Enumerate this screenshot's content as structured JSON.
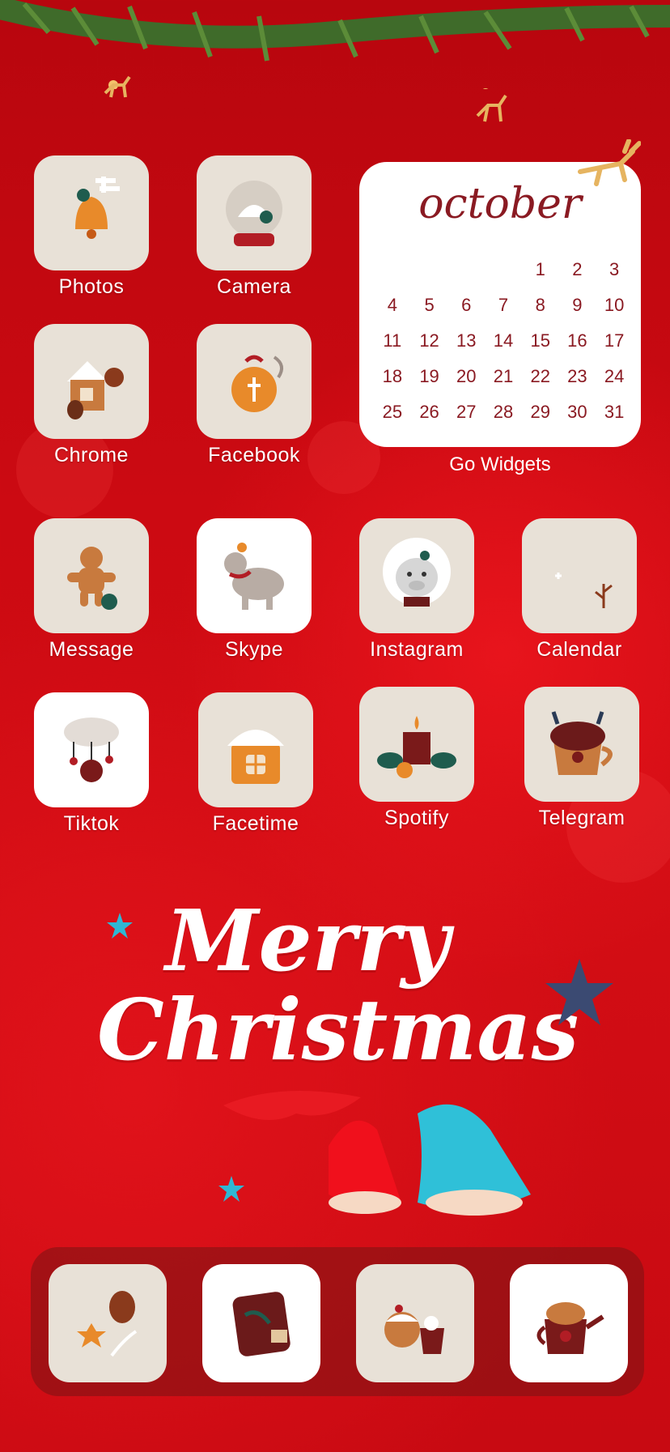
{
  "apps_top": [
    {
      "label": "Photos",
      "icon": "bell-snowflake-icon"
    },
    {
      "label": "Camera",
      "icon": "snow-globe-icon"
    },
    {
      "label": "Chrome",
      "icon": "gingerbread-house-icon"
    },
    {
      "label": "Facebook",
      "icon": "ornament-icon"
    }
  ],
  "widget": {
    "month": "october",
    "days": [
      "",
      "",
      "",
      "",
      "1",
      "2",
      "3",
      "4",
      "5",
      "6",
      "7",
      "8",
      "9",
      "10",
      "11",
      "12",
      "13",
      "14",
      "15",
      "16",
      "17",
      "18",
      "19",
      "20",
      "21",
      "22",
      "23",
      "24",
      "25",
      "26",
      "27",
      "28",
      "29",
      "30",
      "31"
    ],
    "label": "Go Widgets"
  },
  "apps_row3": [
    {
      "label": "Message",
      "icon": "gingerbread-man-icon"
    },
    {
      "label": "Skype",
      "icon": "reindeer-icon"
    },
    {
      "label": "Instagram",
      "icon": "cow-icon"
    },
    {
      "label": "Calendar",
      "icon": "crescent-moon-icon"
    }
  ],
  "apps_row4": [
    {
      "label": "Tiktok",
      "icon": "cloud-ornaments-icon"
    },
    {
      "label": "Facetime",
      "icon": "snowy-house-icon"
    },
    {
      "label": "Spotify",
      "icon": "candle-wreath-icon"
    },
    {
      "label": "Telegram",
      "icon": "reindeer-cup-icon"
    }
  ],
  "banner": {
    "line1": "Merry",
    "line2": "Christmas"
  },
  "dock": [
    {
      "icon": "pinecone-cookie-icon"
    },
    {
      "icon": "gift-box-icon"
    },
    {
      "icon": "pudding-cocoa-icon"
    },
    {
      "icon": "teapot-icon"
    }
  ],
  "colors": {
    "background": "#cc0a12",
    "tile": "#e8e1d7",
    "accent_text": "#8a1a22"
  }
}
